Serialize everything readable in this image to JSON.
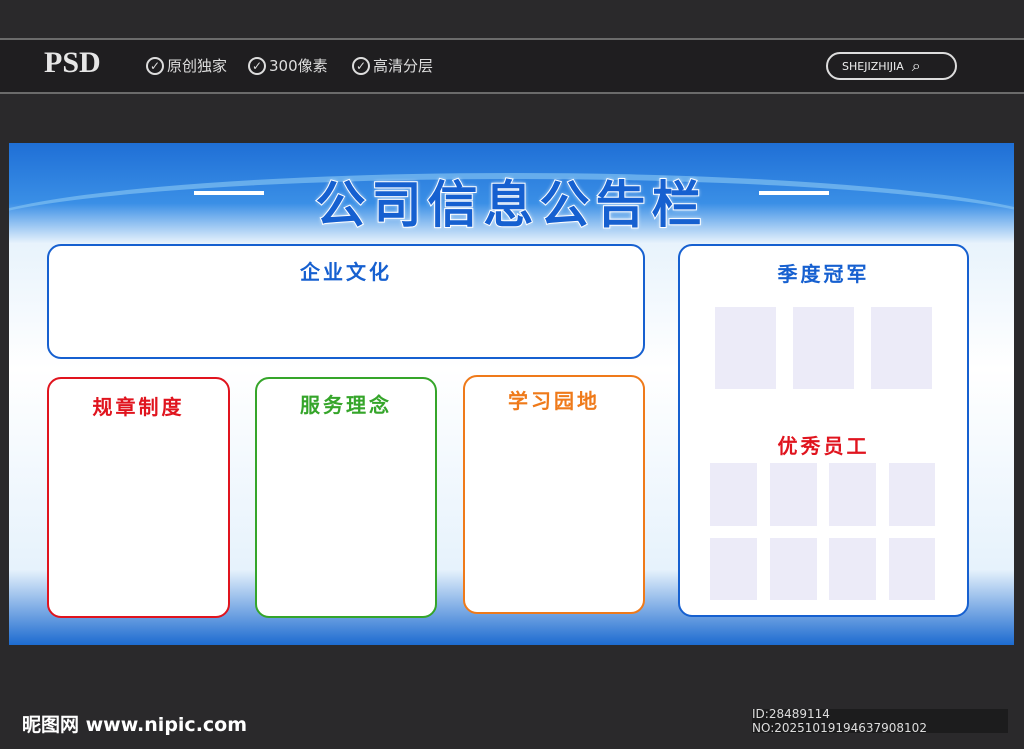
{
  "header": {
    "logo": "PSD",
    "features": [
      "原创独家",
      "300像素",
      "高清分层"
    ],
    "search_label": "SHEJIZHIJIA"
  },
  "board": {
    "title": "公司信息公告栏",
    "sections": {
      "culture": "企业文化",
      "rules": "规章制度",
      "service": "服务理念",
      "learning": "学习园地",
      "champion": "季度冠军",
      "excellent": "优秀员工"
    }
  },
  "footer": {
    "site": "昵图网 www.nipic.com",
    "id_text": "ID:28489114 NO:20251019194637908102"
  },
  "colors": {
    "blue": "#1660d0",
    "red": "#e0141e",
    "green": "#35a52a",
    "orange": "#ef7a1a"
  }
}
